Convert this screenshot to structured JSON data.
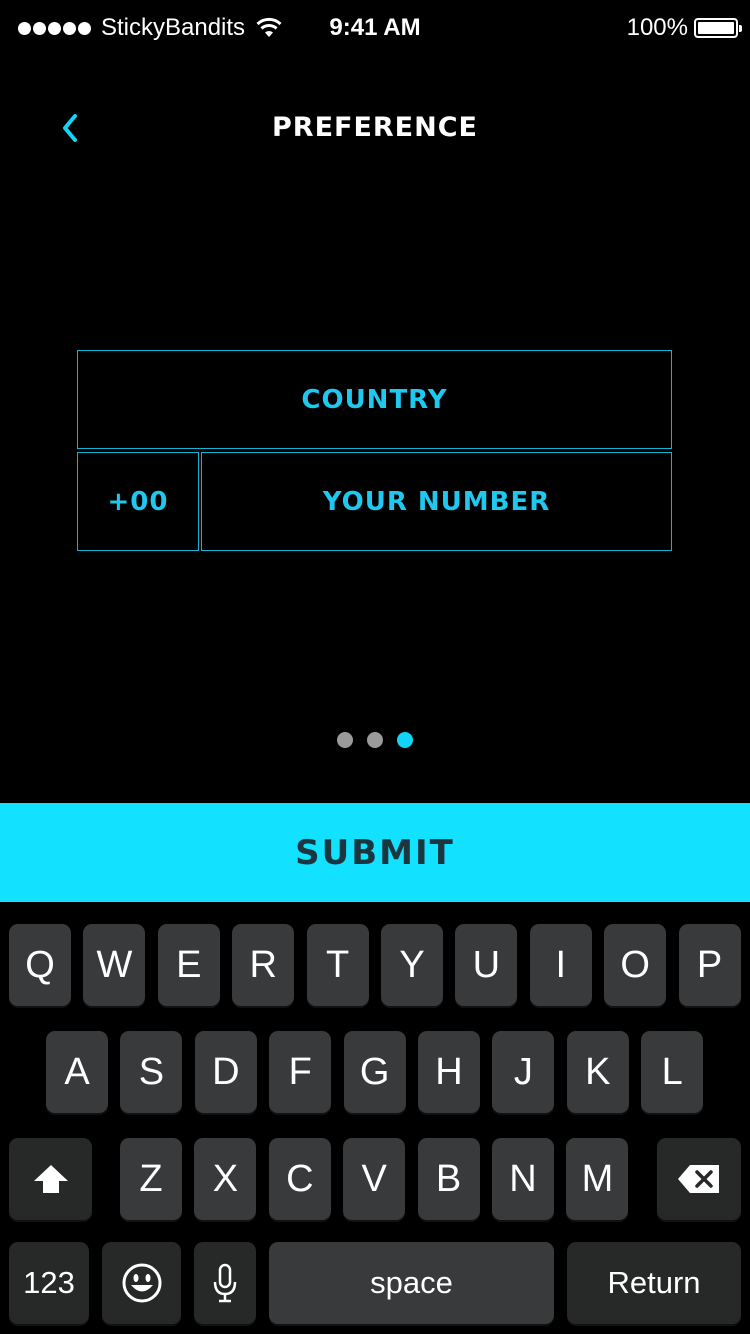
{
  "status_bar": {
    "carrier": "StickyBandits",
    "time": "9:41 AM",
    "battery": "100%",
    "signal_icon": "signal-dots-icon",
    "wifi_icon": "wifi-icon",
    "battery_icon": "battery-icon"
  },
  "nav": {
    "back_icon": "chevron-left-icon",
    "title": "PREFERENCE"
  },
  "form": {
    "country_placeholder": "COUNTRY",
    "country_value": "",
    "code_placeholder": "+00",
    "code_value": "",
    "number_placeholder": "YOUR NUMBER",
    "number_value": ""
  },
  "pager": {
    "count": 3,
    "active_index": 2,
    "active_color": "#12d4f7",
    "inactive_color": "#9a9a9a"
  },
  "submit": {
    "label": "SUBMIT"
  },
  "keyboard": {
    "row1": [
      "Q",
      "W",
      "E",
      "R",
      "T",
      "Y",
      "U",
      "I",
      "O",
      "P"
    ],
    "row2": [
      "A",
      "S",
      "D",
      "F",
      "G",
      "H",
      "J",
      "K",
      "L"
    ],
    "row3": [
      "Z",
      "X",
      "C",
      "V",
      "B",
      "N",
      "M"
    ],
    "shift_icon": "shift-icon",
    "delete_icon": "delete-icon",
    "numbers_label": "123",
    "emoji_icon": "emoji-icon",
    "mic_icon": "microphone-icon",
    "space_label": "space",
    "return_label": "Return"
  },
  "colors": {
    "accent": "#12e2ff",
    "field_border": "#0fb4d6",
    "key": "#383a3b"
  }
}
